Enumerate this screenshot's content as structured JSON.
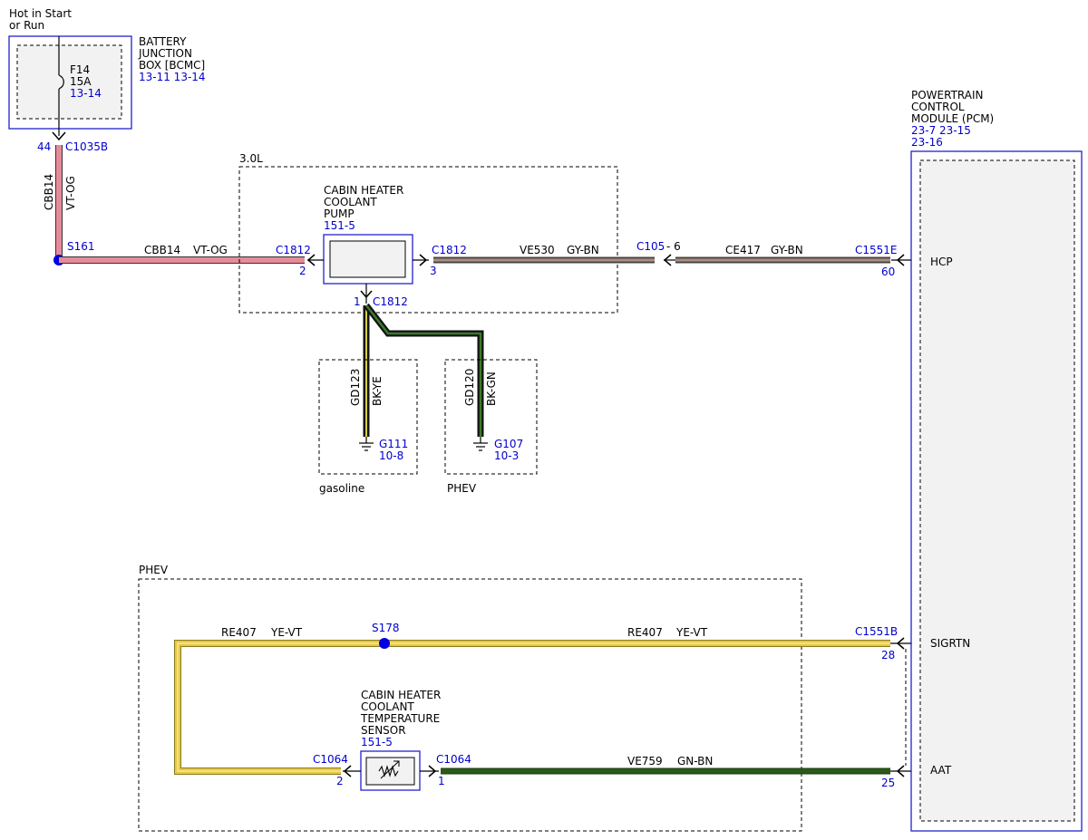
{
  "top_note": {
    "line1": "Hot in Start",
    "line2": "or Run"
  },
  "bcmc": {
    "name_lines": [
      "BATTERY",
      "JUNCTION",
      "BOX [BCMC]"
    ],
    "refs": "13-11 13-14",
    "fuse_name": "F14",
    "fuse_rating": "15A",
    "fuse_ref": "13-14",
    "connector": "C1035B",
    "pin": "44"
  },
  "wire_cbb14_vertical": {
    "circuit": "CBB14",
    "color": "VT-OG"
  },
  "splice_s161": "S161",
  "wire_cbb14_horizontal": {
    "circuit": "CBB14",
    "color": "VT-OG"
  },
  "region_3_0l": "3.0L",
  "pump": {
    "name_lines": [
      "CABIN HEATER",
      "COOLANT",
      "PUMP"
    ],
    "ref": "151-5",
    "left_connector": "C1812",
    "left_pin": "2",
    "right_connector": "C1812",
    "right_pin": "3",
    "bottom_pin": "1",
    "bottom_connector": "C1812"
  },
  "wire_ve530": {
    "circuit": "VE530",
    "color": "GY-BN"
  },
  "inline_c105": {
    "connector": "C105",
    "pin": "- 6"
  },
  "wire_ce417": {
    "circuit": "CE417",
    "color": "GY-BN"
  },
  "pcm": {
    "name_lines": [
      "POWERTRAIN",
      "CONTROL",
      "MODULE (PCM)"
    ],
    "refs_line1": "23-7  23-15",
    "refs_line2": "23-16",
    "hcp_connector": "C1551E",
    "hcp_pin": "60",
    "hcp_label": "HCP",
    "sigrtn_connector": "C1551B",
    "sigrtn_pin": "28",
    "sigrtn_label": "SIGRTN",
    "aat_pin": "25",
    "aat_label": "AAT"
  },
  "ground_gasoline": {
    "circuit": "GD123",
    "color": "BK-YE",
    "ground": "G111",
    "ref": "10-8",
    "region": "gasoline"
  },
  "ground_phev": {
    "circuit": "GD120",
    "color": "BK-GN",
    "ground": "G107",
    "ref": "10-3",
    "region": "PHEV"
  },
  "region_phev_bottom": "PHEV",
  "wire_re407_left": {
    "circuit": "RE407",
    "color": "YE-VT"
  },
  "splice_s178": "S178",
  "wire_re407_right": {
    "circuit": "RE407",
    "color": "YE-VT"
  },
  "sensor": {
    "name_lines": [
      "CABIN HEATER",
      "COOLANT",
      "TEMPERATURE",
      "SENSOR"
    ],
    "ref": "151-5",
    "left_connector": "C1064",
    "left_pin": "2",
    "right_connector": "C1064",
    "right_pin": "1"
  },
  "wire_ve759": {
    "circuit": "VE759",
    "color": "GN-BN"
  },
  "colors": {
    "violet_orange": "#e88a9a",
    "grey_brown": "#8a6a5c",
    "yellow_violet": "#e8c840",
    "green_brown": "#2a5a1a",
    "black_yellow": "#222200",
    "black_green": "#1f4a1f",
    "connector_blue": "#0000d0"
  }
}
